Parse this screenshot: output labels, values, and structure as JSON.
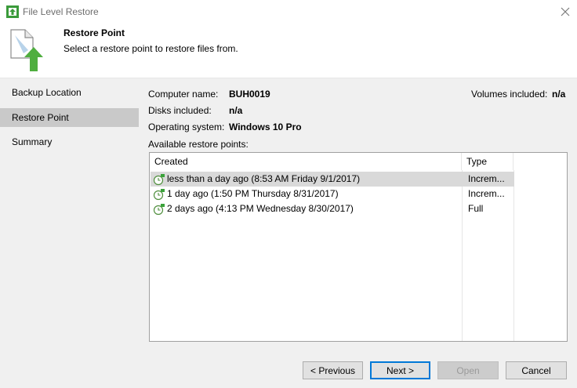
{
  "window": {
    "title": "File Level Restore"
  },
  "header": {
    "title": "Restore Point",
    "subtitle": "Select a restore point to restore files from."
  },
  "sidebar": {
    "items": [
      {
        "label": "Backup Location",
        "active": false
      },
      {
        "label": "Restore Point",
        "active": true
      },
      {
        "label": "Summary",
        "active": false
      }
    ]
  },
  "details": {
    "computer_name_label": "Computer name:",
    "computer_name": "BUH0019",
    "disks_label": "Disks included:",
    "disks": "n/a",
    "os_label": "Operating system:",
    "os": "Windows 10 Pro",
    "volumes_label": "Volumes included:",
    "volumes": "n/a",
    "available_label": "Available restore points:"
  },
  "list": {
    "columns": {
      "created": "Created",
      "type": "Type"
    },
    "rows": [
      {
        "created": "less than a day ago (8:53 AM Friday 9/1/2017)",
        "type": "Increm...",
        "selected": true
      },
      {
        "created": "1 day ago (1:50 PM Thursday 8/31/2017)",
        "type": "Increm...",
        "selected": false
      },
      {
        "created": "2 days ago (4:13 PM Wednesday 8/30/2017)",
        "type": "Full",
        "selected": false
      }
    ]
  },
  "buttons": {
    "previous": "< Previous",
    "next": "Next >",
    "open": "Open",
    "cancel": "Cancel"
  },
  "colors": {
    "accent": "#0078d7",
    "selection": "#d9d9d9",
    "nav_active": "#c9c9c9",
    "panel": "#f0f0f0",
    "icon_green": "#3a9a3a"
  }
}
